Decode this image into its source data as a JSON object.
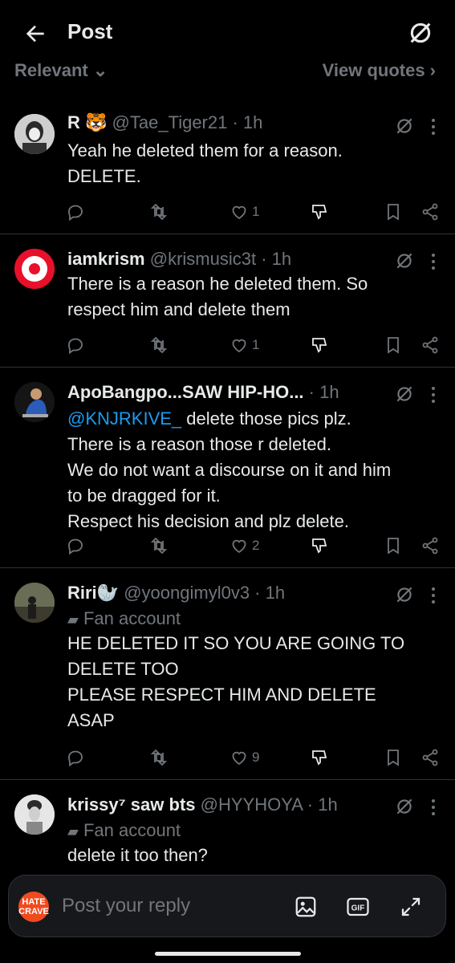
{
  "header": {
    "title": "Post"
  },
  "filter": {
    "left_label": "Relevant ⌄",
    "right_label": "View quotes ›"
  },
  "posts": [
    {
      "name": "R 🐯",
      "handle": "@Tae_Tiger21 · 1h",
      "lines": [
        "Yeah he deleted them for a reason.",
        "DELETE."
      ],
      "likes": "1"
    },
    {
      "name": "iamkrism",
      "handle": "@krismusic3t · 1h",
      "lines": [
        "There is a reason he deleted them. So",
        "respect him and delete them"
      ],
      "likes": "1"
    },
    {
      "name": "ApoBangpo...SAW HIP-HO...",
      "handle": "· 1h",
      "mention": "@KNJRKIVE_",
      "lines": [
        " delete those pics plz.",
        "There is a reason those r deleted.",
        "We do not want a discourse on it and him",
        "to be dragged for it.",
        "Respect his decision and plz delete."
      ],
      "likes": "2"
    },
    {
      "name": "Riri🦭",
      "handle": "@yoongimyl0v3 · 1h",
      "fan_label": "Fan account",
      "lines": [
        "HE DELETED IT SO YOU ARE GOING TO",
        "DELETE TOO",
        "PLEASE RESPECT HIM AND DELETE",
        "ASAP"
      ],
      "likes": "9"
    },
    {
      "name": "krissy⁷ saw bts",
      "handle": "@HYYHOYA · 1h",
      "fan_label": "Fan account",
      "lines": [
        "delete it too then?"
      ]
    }
  ],
  "reply": {
    "placeholder": "Post your reply",
    "logo_text": "HATE CRAVE"
  },
  "colors": {
    "background": "#000000",
    "text": "#e7e9ea",
    "muted": "#71767b",
    "link": "#1d9bf0",
    "divider": "#2f3336"
  }
}
